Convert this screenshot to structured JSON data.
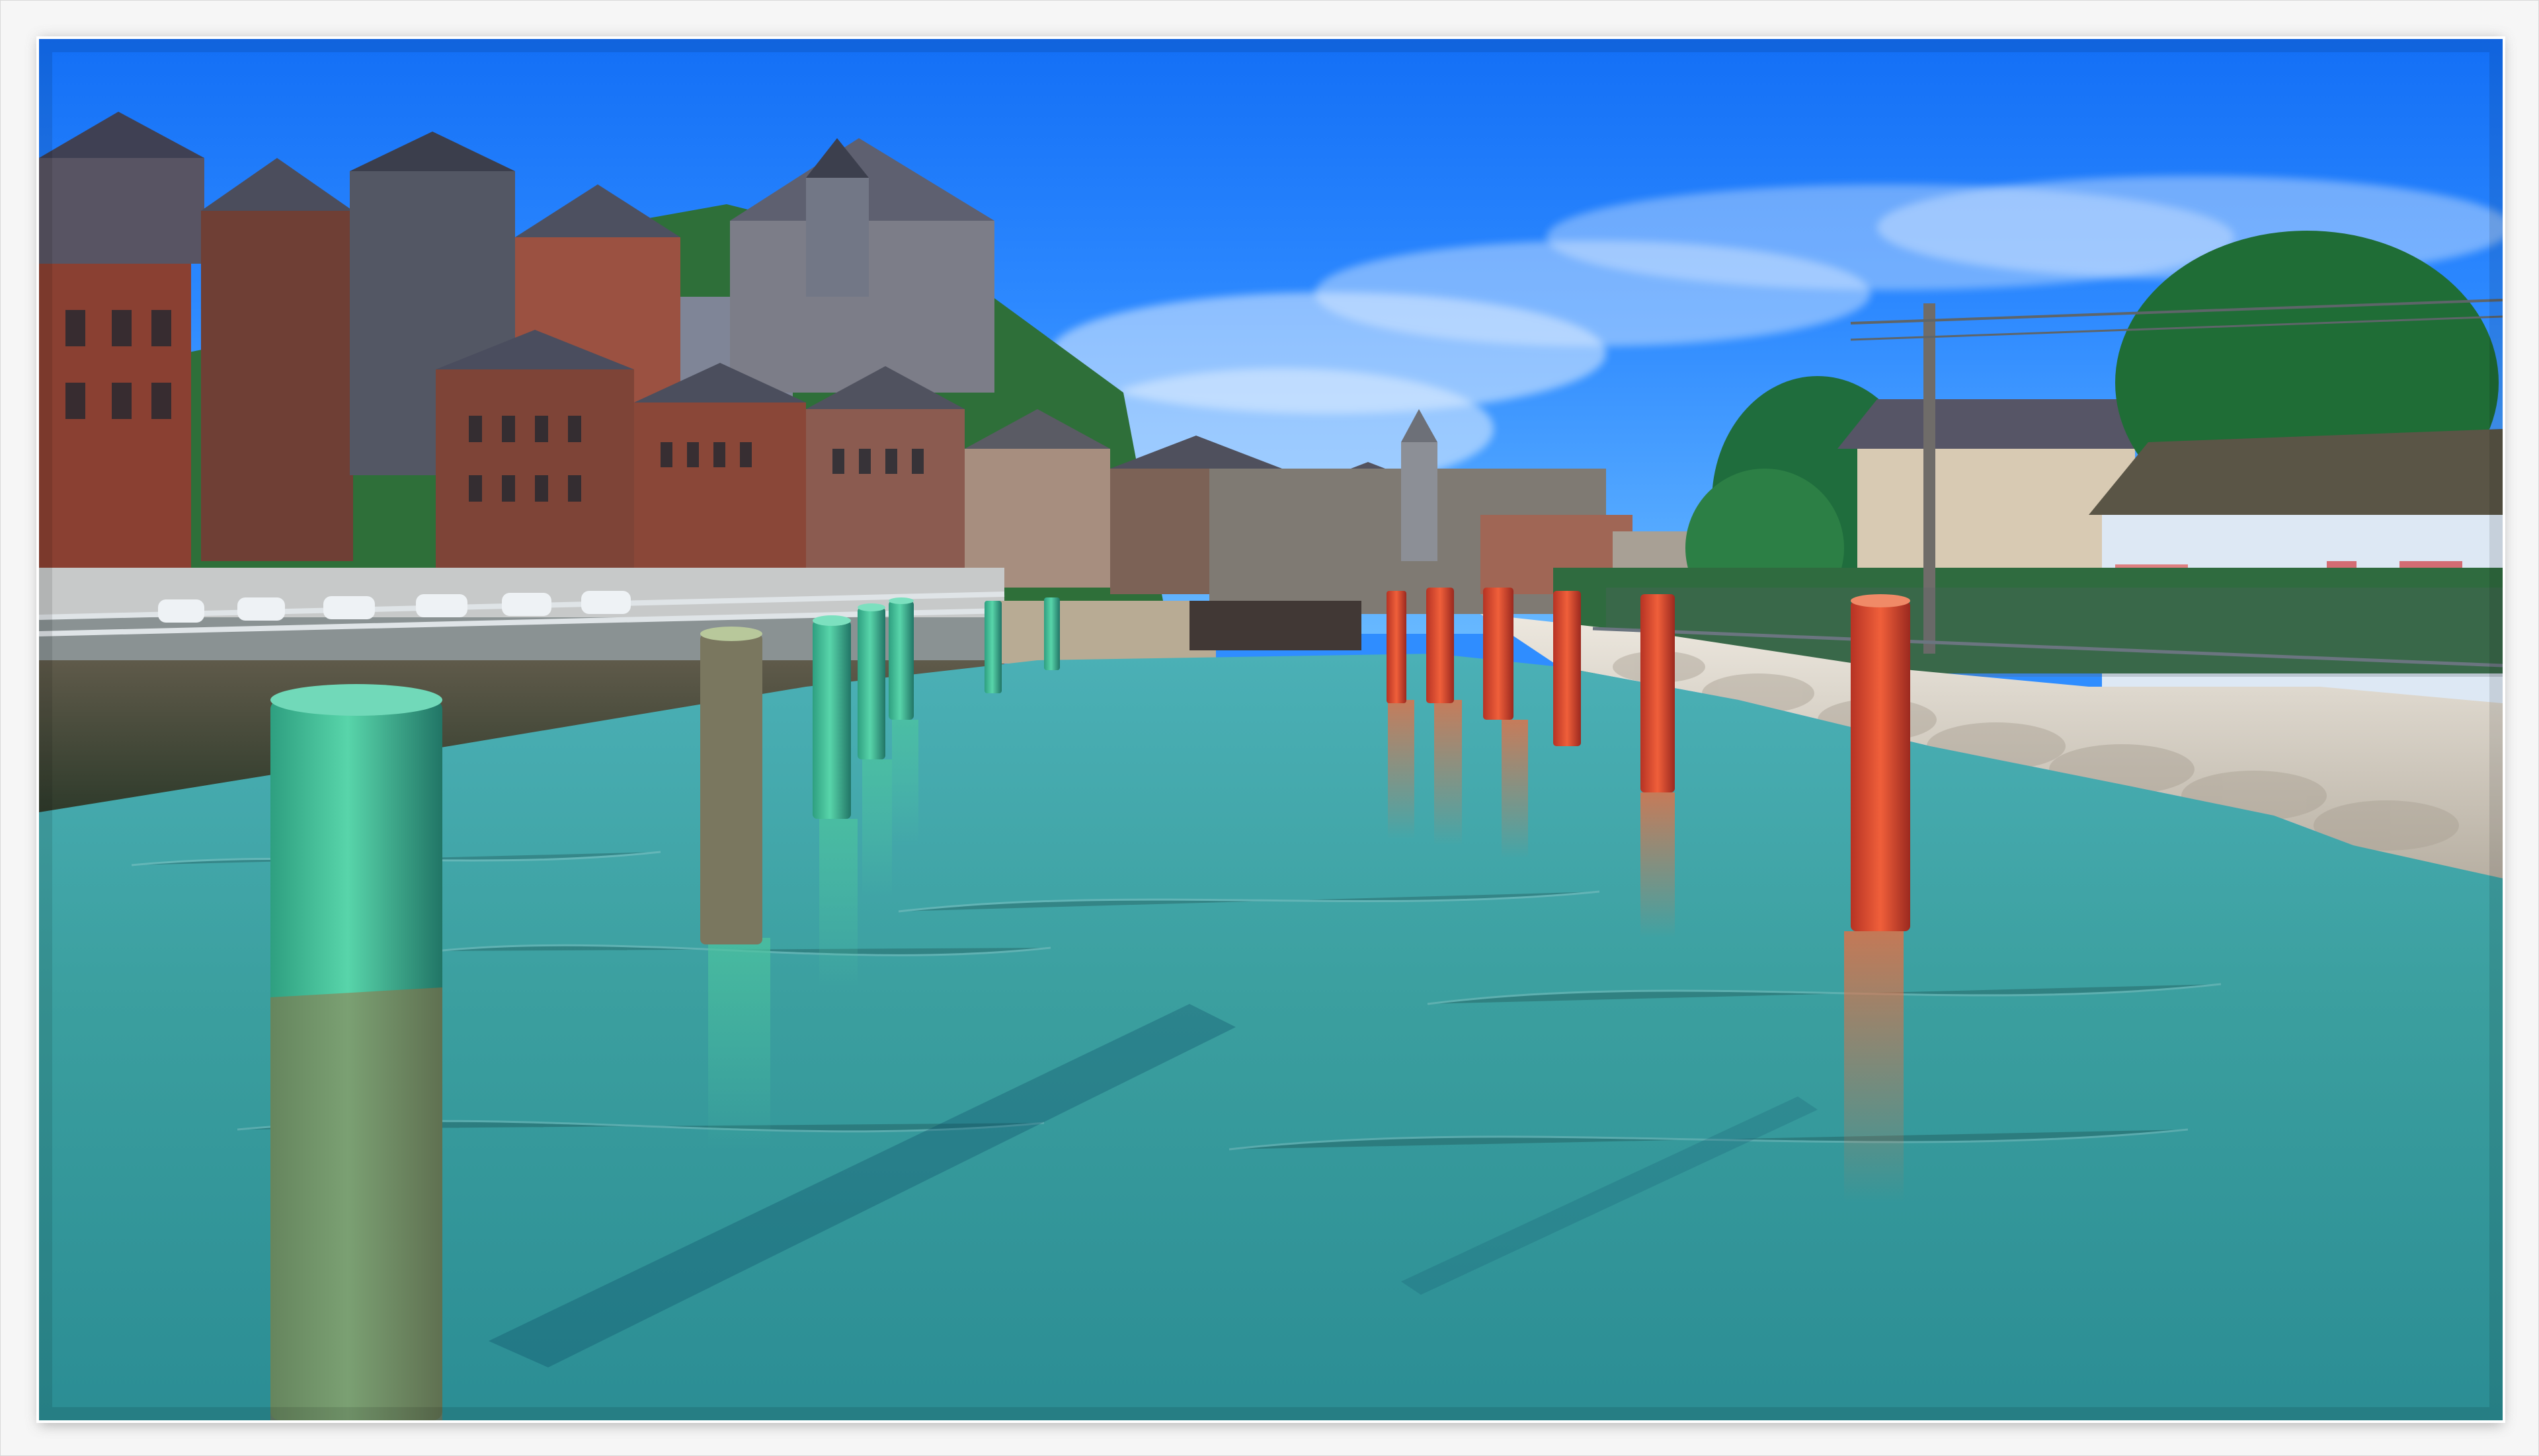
{
  "image": {
    "type": "framed-photo",
    "dominant_colors": {
      "sky": "#2d89ff",
      "water": "#3ea6a2",
      "stone": "#d8d2c8",
      "left_post_color": "#39b48f",
      "right_post_color": "#e04b2e",
      "roof": "#4e5162",
      "brick": "#8b4033"
    }
  }
}
